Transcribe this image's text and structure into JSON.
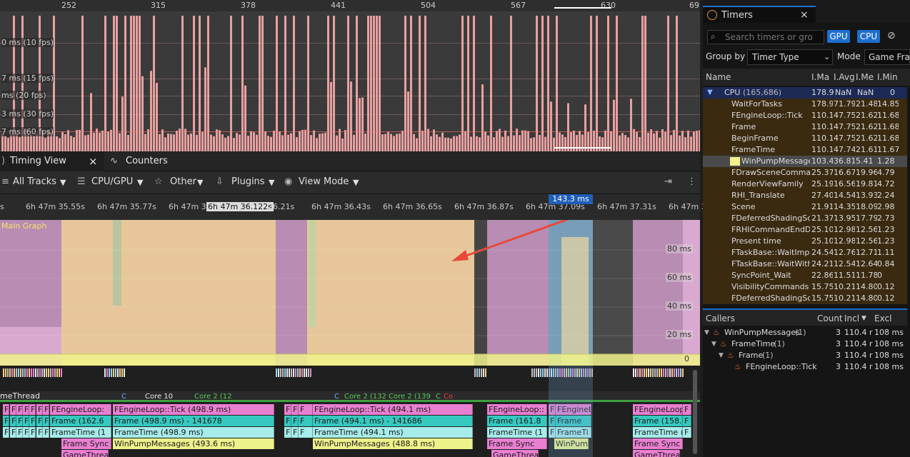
{
  "frames_chart": {
    "frame_numbers": [
      "252",
      "315",
      "378",
      "441",
      "504",
      "567",
      "630",
      "69"
    ],
    "fps_labels": [
      "0 ms (10 fps)",
      "7 ms (15 fps)",
      "ms (20 fps)",
      "3 ms (30 fps)",
      "7 ms (60 fps)"
    ]
  },
  "tabs": {
    "timing_view": "Timing View",
    "counters": "Counters",
    "close_glyph": "×"
  },
  "toolbar": {
    "all_tracks": "All Tracks",
    "cpu_gpu": "CPU/GPU",
    "other": "Other",
    "plugins": "Plugins",
    "view_mode": "View Mode"
  },
  "time_ruler": {
    "ticks": [
      "s",
      "6h 47m 35.55s",
      "6h 47m 35.77s",
      "6h 47m 35",
      "6h 47m 36.122s",
      "36.21s",
      "6h 47m 36.43s",
      "6h 47m 36.65s",
      "6h 47m 36.87s",
      "6h 47m 37.09s",
      "6h 47m 37.31s",
      "6h 47m 3"
    ],
    "selection": "143.3 ms"
  },
  "graph": {
    "title": "Main Graph",
    "y_labels": [
      "80 ms",
      "60 ms",
      "40 ms",
      "20 ms",
      "0"
    ]
  },
  "tracks": {
    "thread_label": "meThread",
    "core_labels": [
      "C",
      "Core 10",
      "Core 2 (12",
      "C",
      "Core 2 (132 Core 2 (139",
      "C",
      "Co"
    ],
    "row1": [
      "F",
      "F",
      "F",
      "F",
      "F",
      "F",
      "F",
      "FEngineLoop:",
      "FEngineLoop::Tick (498.9 ms)",
      "F",
      "F",
      "F",
      "FEngineLoop::Tick (494.1 ms)",
      "FEngineLoop::",
      "F",
      "FEngineL",
      "FEngineLoop::",
      "F"
    ],
    "row2": [
      "F",
      "F",
      "F",
      "F",
      "F",
      "F",
      "Fr",
      "Frame (162.6",
      "Frame (498.9 ms) -  141678",
      "F",
      "F",
      "F",
      "Frame (494.1 ms) -  141686",
      "Frame (161.8",
      "F",
      "Frame",
      "Frame (158.1",
      "F"
    ],
    "row3": [
      "F",
      "F",
      "F",
      "F",
      "F",
      "F",
      "Fr",
      "FrameTime (1",
      "FrameTime (498.9 ms)",
      "F",
      "F",
      "F",
      "FrameTime (494.1 ms)",
      "FrameTime (1",
      "F",
      "FrameTi",
      "FrameTime (",
      "F"
    ],
    "row4": [
      "Frame Sync",
      "WinPumpMessages (493.6 ms)",
      "WinPumpMessages (488.8 ms)",
      "Frame Sync",
      "WinPum",
      "Frame Sync"
    ],
    "row5": [
      "GameThread",
      "GameThread",
      "GameThread"
    ]
  },
  "timers": {
    "title": "Timers",
    "search_placeholder": "Search timers or gro",
    "gpu_btn": "GPU",
    "cpu_btn": "CPU",
    "group_by_label": "Group by",
    "group_by_value": "Timer Type",
    "mode_label": "Mode",
    "mode_value": "Game Fra",
    "columns": [
      "Name",
      "I.Ma",
      "I.Avg",
      "I.Me",
      "I.Min"
    ],
    "cpu_group": {
      "name": "CPU",
      "count": "(165,686)",
      "vals": [
        "178.9",
        "NaN",
        "NaN",
        "0"
      ]
    },
    "rows": [
      {
        "name": "WaitForTasks",
        "v": [
          "178.9",
          "71.79",
          "21.48",
          "14.85"
        ]
      },
      {
        "name": "FEngineLoop::Tick",
        "v": [
          "110.1",
          "47.75",
          "21.62",
          "11.68"
        ]
      },
      {
        "name": "Frame",
        "v": [
          "110.1",
          "47.75",
          "21.62",
          "11.68"
        ]
      },
      {
        "name": "BeginFrame",
        "v": [
          "110.1",
          "47.75",
          "21.62",
          "11.68"
        ]
      },
      {
        "name": "FrameTime",
        "v": [
          "110.1",
          "47.74",
          "21.61",
          "11.67"
        ]
      },
      {
        "name": "WinPumpMessages",
        "v": [
          "103.4",
          "36.81",
          "5.41",
          "1.28"
        ]
      },
      {
        "name": "FDrawSceneCommand",
        "v": [
          "25.37",
          "16.67",
          "19.96",
          "4.79"
        ]
      },
      {
        "name": "RenderViewFamily",
        "v": [
          "25.19",
          "16.56",
          "19.81",
          "4.72"
        ]
      },
      {
        "name": "RHI_Translate",
        "v": [
          "27.40",
          "14.54",
          "13.93",
          "2.24"
        ]
      },
      {
        "name": "Scene",
        "v": [
          "21.91",
          "14.35",
          "18.09",
          "2.98"
        ]
      },
      {
        "name": "FDeferredShadingSce",
        "v": [
          "21.37",
          "13.95",
          "17.79",
          "2.73"
        ]
      },
      {
        "name": "FRHICommandEndDra",
        "v": [
          "25.10",
          "12.98",
          "12.56",
          "1.23"
        ]
      },
      {
        "name": "Present time",
        "v": [
          "25.10",
          "12.98",
          "12.56",
          "1.23"
        ]
      },
      {
        "name": "FTaskBase::WaitImpl_",
        "v": [
          "24.54",
          "12.76",
          "12.71",
          "1.11"
        ]
      },
      {
        "name": "FTaskBase::WaitWithI",
        "v": [
          "24.21",
          "12.54",
          "12.64",
          "0.84"
        ]
      },
      {
        "name": "SyncPoint_Wait",
        "v": [
          "22.86",
          "11.51",
          "11.78",
          "0"
        ]
      },
      {
        "name": "VisibilityCommands",
        "v": [
          "15.75",
          "10.21",
          "14.80",
          "0.12"
        ]
      },
      {
        "name": "FDeferredShadingSce",
        "v": [
          "15.75",
          "10.21",
          "14.80",
          "0.12"
        ]
      }
    ]
  },
  "callers": {
    "columns": [
      "Callers",
      "Count",
      "Incl",
      "Excl"
    ],
    "rows": [
      {
        "name": "WinPumpMessages",
        "n": "(1)",
        "count": "3",
        "incl": "110.4 r",
        "excl": "108 ms"
      },
      {
        "name": "FrameTime",
        "n": "(1)",
        "count": "3",
        "incl": "110.4 r",
        "excl": "108 ms"
      },
      {
        "name": "Frame",
        "n": "(1)",
        "count": "3",
        "incl": "110.4 r",
        "excl": "108 ms"
      },
      {
        "name": "FEngineLoop::Tick",
        "n": "",
        "count": "3",
        "incl": "110.4 r",
        "excl": "108 ms"
      }
    ]
  },
  "colors": {
    "pink": "#e87fd0",
    "teal": "#35c9c0",
    "yellow": "#eef28a",
    "cyan": "#a6ecea",
    "graph_fill": "#e7c79a",
    "graph_pink": "#b98cb3",
    "accent": "#1e6fd0"
  }
}
